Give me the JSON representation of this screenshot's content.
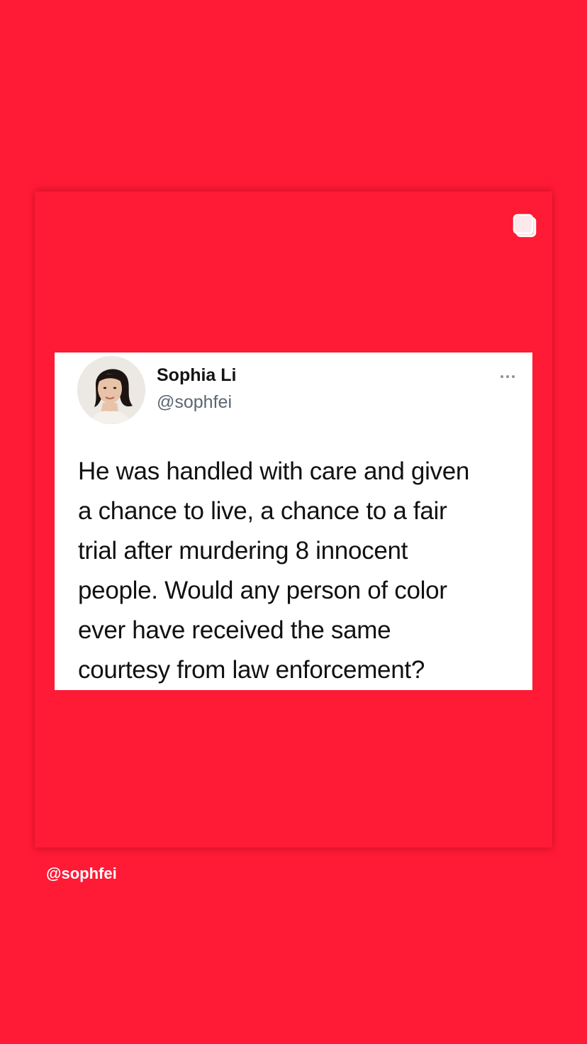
{
  "colors": {
    "background": "#ff1a35",
    "card": "#ffffff",
    "name": "#141414",
    "handle": "#5b6670",
    "text": "#111111"
  },
  "story": {
    "carousel_icon": "multiple-posts-icon",
    "mention": "@sophfei"
  },
  "tweet": {
    "display_name": "Sophia Li",
    "handle": "@sophfei",
    "more_icon": "more-options-icon",
    "text": "He was handled with care and given\na chance to live, a chance to a fair\ntrial after murdering 8 innocent\npeople. Would any person of color\never have received the same\ncourtesy from law enforcement?"
  }
}
